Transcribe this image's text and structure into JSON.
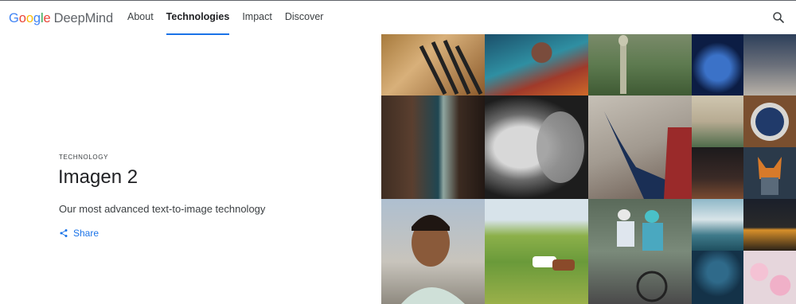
{
  "logo": {
    "google": [
      "G",
      "o",
      "o",
      "g",
      "l",
      "e"
    ],
    "product": "DeepMind"
  },
  "nav": {
    "items": [
      {
        "label": "About"
      },
      {
        "label": "Technologies",
        "active": true
      },
      {
        "label": "Impact"
      },
      {
        "label": "Discover"
      }
    ]
  },
  "hero": {
    "eyebrow": "TECHNOLOGY",
    "title": "Imagen 2",
    "subtitle": "Our most advanced text-to-image technology",
    "share_label": "Share"
  },
  "icons": {
    "search": "search-icon",
    "share": "share-icon"
  },
  "colors": {
    "accent": "#1a73e8",
    "text": "#202124"
  },
  "gallery": [
    {
      "name": "tile-zebra"
    },
    {
      "name": "tile-portrait-blue"
    },
    {
      "name": "tile-marsh-figure"
    },
    {
      "name": "tile-globes"
    },
    {
      "name": "tile-city-street"
    },
    {
      "name": "tile-alley"
    },
    {
      "name": "tile-elderly-couple"
    },
    {
      "name": "tile-city-hand"
    },
    {
      "name": "tile-green-room"
    },
    {
      "name": "tile-blueberries"
    },
    {
      "name": "tile-dark-street"
    },
    {
      "name": "tile-fox-knight"
    },
    {
      "name": "tile-young-man"
    },
    {
      "name": "tile-horses-hills"
    },
    {
      "name": "tile-cyclists"
    },
    {
      "name": "tile-sea-clouds"
    },
    {
      "name": "tile-night-house"
    },
    {
      "name": "tile-flowers-vase"
    },
    {
      "name": "tile-cherry-blossoms"
    }
  ]
}
